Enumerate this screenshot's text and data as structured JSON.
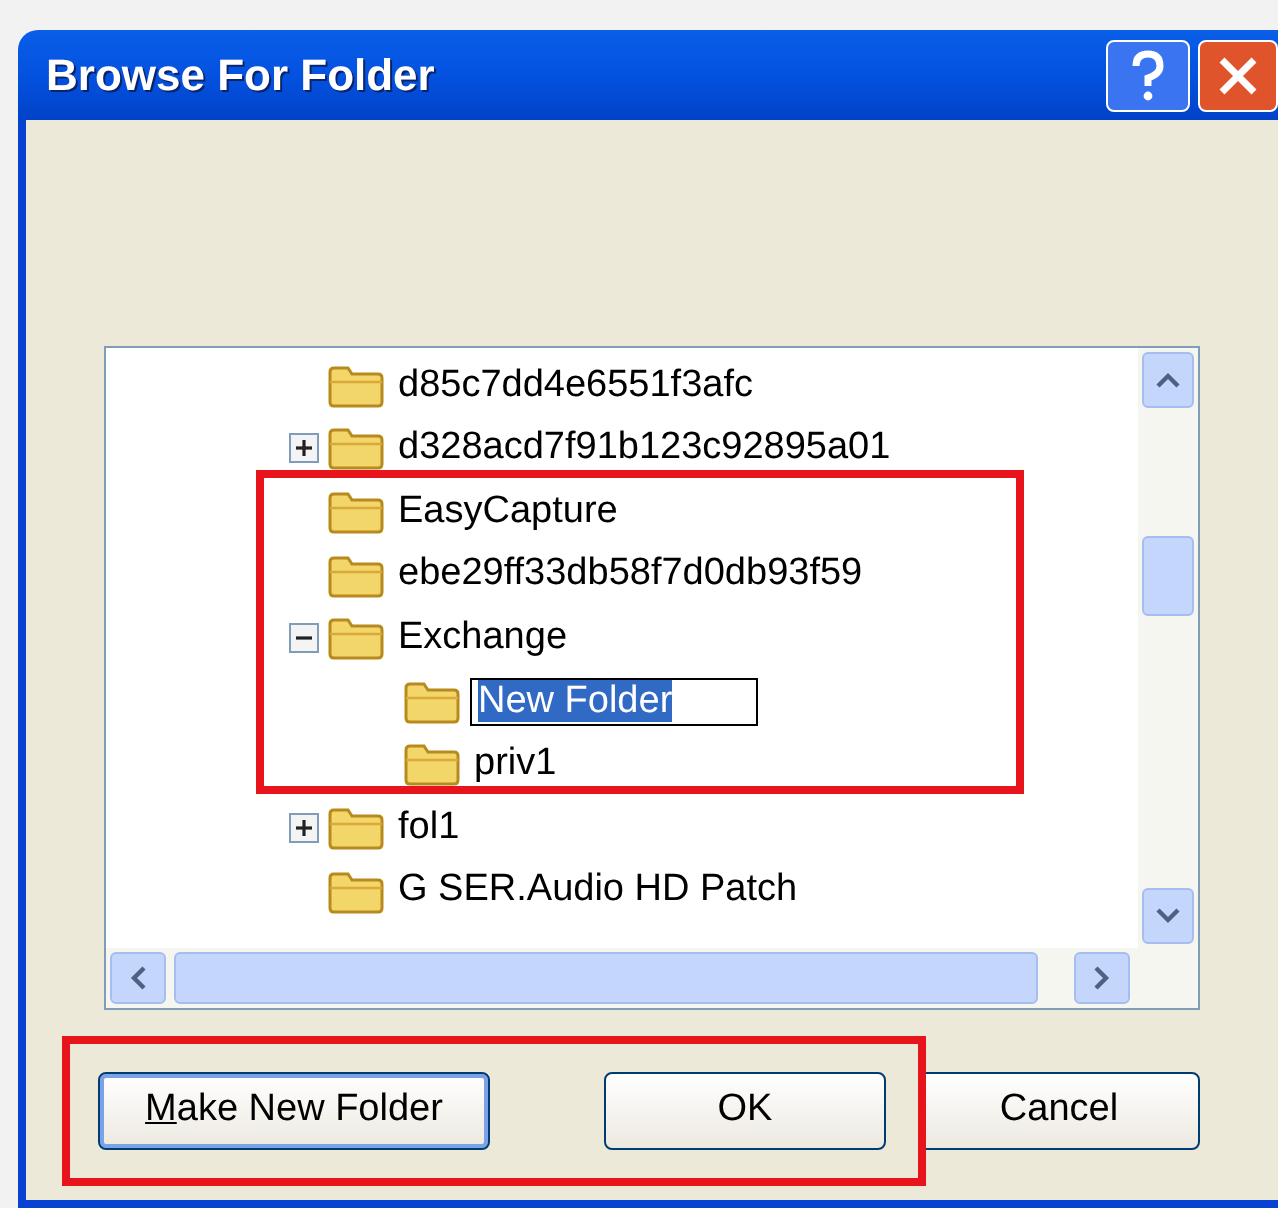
{
  "window": {
    "title": "Browse For Folder"
  },
  "tree": [
    {
      "label": "d85c7dd4e6551f3afc",
      "kind": "leaf",
      "renaming": false
    },
    {
      "label": "d328acd7f91b123c92895a01",
      "kind": "branch",
      "expanded": false,
      "renaming": false
    },
    {
      "label": "EasyCapture",
      "kind": "leaf",
      "renaming": false
    },
    {
      "label": "ebe29ff33db58f7d0db93f59",
      "kind": "leaf",
      "renaming": false
    },
    {
      "label": "Exchange",
      "kind": "branch",
      "expanded": true,
      "renaming": false,
      "children": [
        {
          "label": "New Folder",
          "renaming": true
        },
        {
          "label": "priv1",
          "renaming": false
        }
      ]
    },
    {
      "label": "fol1",
      "kind": "branch",
      "expanded": false,
      "renaming": false
    },
    {
      "label": "G SER.Audio HD Patch",
      "kind": "leaf",
      "renaming": false
    }
  ],
  "buttons": [
    {
      "label": "Make New Folder",
      "mnemonic": true,
      "default": true
    },
    {
      "label": "OK",
      "mnemonic": false,
      "default": false
    },
    {
      "label": "Cancel",
      "mnemonic": false,
      "default": false
    }
  ]
}
